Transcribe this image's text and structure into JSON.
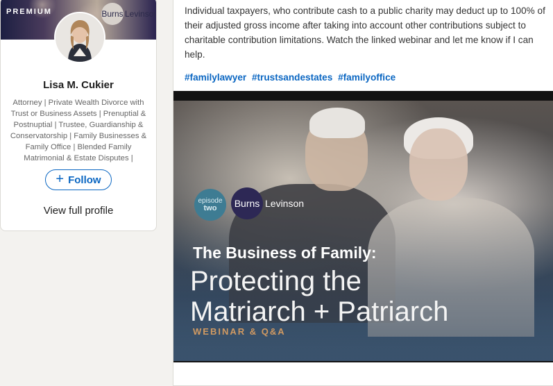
{
  "profile": {
    "premium_label": "PREMIUM",
    "banner_logo_left": "Burns",
    "banner_logo_right": "Levinson",
    "name": "Lisa M. Cukier",
    "headline": "Attorney | Private Wealth Divorce with Trust or Business Assets | Prenuptial & Postnuptial | Trustee, Guardianship & Conservatorship | Family Businesses & Family Office | Blended Family Matrimonial & Estate Disputes |",
    "follow_label": "Follow",
    "view_profile_label": "View full profile"
  },
  "post": {
    "text": "Individual taxpayers, who contribute cash to a public charity may deduct up to 100% of their adjusted gross income after taking into account other contributions subject to charitable contribution limitations. Watch the linked webinar and let me know if I can help.",
    "hashtags": [
      "#familylawyer",
      "#trustsandestates",
      "#familyoffice"
    ],
    "media": {
      "episode_top": "episode",
      "episode_bottom": "two",
      "brand_left": "Burns",
      "brand_right": "Levinson",
      "title": "The Business of Family:",
      "big_line1": "Protecting the",
      "big_line2": "Matriarch + Patriarch",
      "subtitle": "WEBINAR & Q&A"
    }
  },
  "colors": {
    "accent": "#0a66c2",
    "page_bg": "#f3f2ef",
    "webinar_accent": "#d19a62"
  }
}
